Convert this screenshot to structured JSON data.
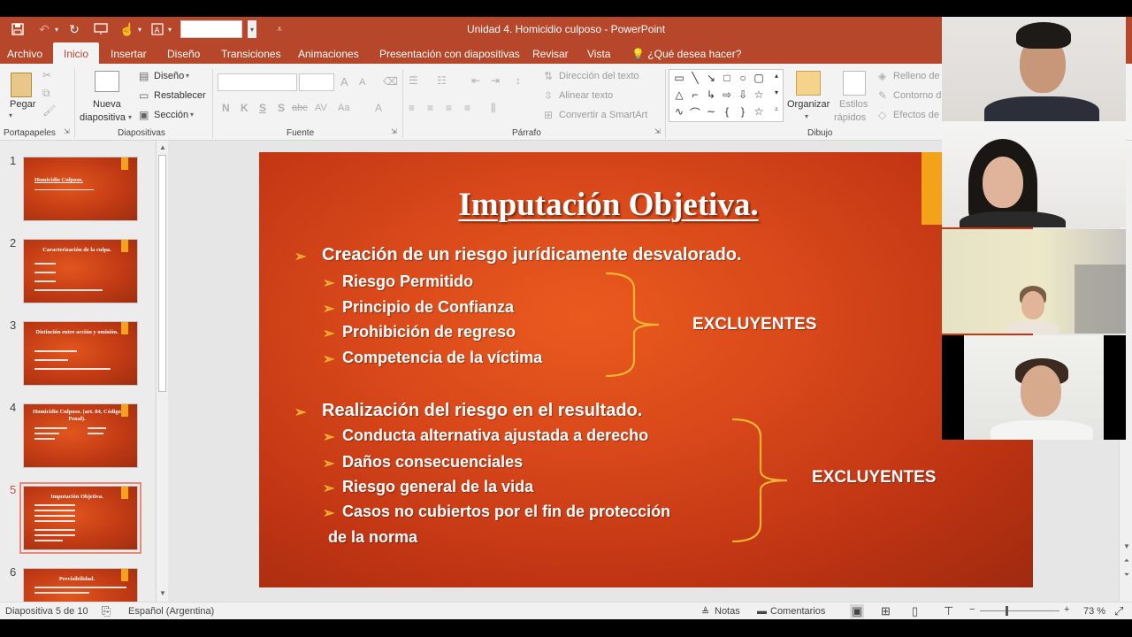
{
  "window": {
    "title": "Unidad 4. Homicidio culposo - PowerPoint"
  },
  "tabs": [
    "Archivo",
    "Inicio",
    "Insertar",
    "Diseño",
    "Transiciones",
    "Animaciones",
    "Presentación con diapositivas",
    "Revisar",
    "Vista",
    "¿Qué desea hacer?"
  ],
  "ribbon": {
    "portapapeles": {
      "paste": "Pegar",
      "group": "Portapapeles"
    },
    "diapositivas": {
      "new_line1": "Nueva",
      "new_line2": "diapositiva",
      "layout": "Diseño",
      "reset": "Restablecer",
      "section": "Sección",
      "group": "Diapositivas"
    },
    "fuente": {
      "group": "Fuente",
      "bold": "N",
      "italic": "K",
      "underline": "S",
      "shadow": "S",
      "strike": "abc",
      "spacing": "AV",
      "case": "Aa",
      "color": "A",
      "grow": "A",
      "shrink": "A"
    },
    "parrafo": {
      "group": "Párrafo",
      "text_direction": "Dirección del texto",
      "align_text": "Alinear texto",
      "smartart": "Convertir a SmartArt"
    },
    "dibujo": {
      "group": "Dibujo",
      "arrange": "Organizar",
      "styles_line1": "Estilos",
      "styles_line2": "rápidos",
      "fill": "Relleno de",
      "outline": "Contorno d",
      "effects": "Efectos de"
    }
  },
  "thumbnails": [
    {
      "num": "1",
      "title": "Homicidio Culposo."
    },
    {
      "num": "2",
      "title": "Caracterización de la culpa."
    },
    {
      "num": "3",
      "title": "Distinción entre acción y omisión."
    },
    {
      "num": "4",
      "title": "Homicidio Culposo. (art. 84, Código Penal)."
    },
    {
      "num": "5",
      "title": "Imputación Objetiva."
    },
    {
      "num": "6",
      "title": "Previsibilidad."
    }
  ],
  "slide": {
    "title": "Imputación Objetiva.",
    "group1": {
      "heading": "Creación de un riesgo jurídicamente desvalorado.",
      "items": [
        "Riesgo Permitido",
        "Principio de Confianza",
        "Prohibición de regreso",
        "Competencia de la víctima"
      ],
      "label": "EXCLUYENTES"
    },
    "group2": {
      "heading": "Realización del riesgo en el resultado.",
      "items": [
        "Conducta alternativa ajustada a derecho",
        "Daños consecuenciales",
        "Riesgo general de la vida",
        "Casos no cubiertos por el fin de protección"
      ],
      "continuation": "de la norma",
      "label": "EXCLUYENTES"
    },
    "bullet_glyph": "➢"
  },
  "statusbar": {
    "slide_count": "Diapositiva 5 de 10",
    "language": "Español (Argentina)",
    "notes": "Notas",
    "comments": "Comentarios",
    "zoom": "73 %"
  },
  "colors": {
    "accent": "#b7472a",
    "slide_bg": "#d8481a",
    "bracket": "#f7b532",
    "orange_tab": "#f4a21a"
  }
}
